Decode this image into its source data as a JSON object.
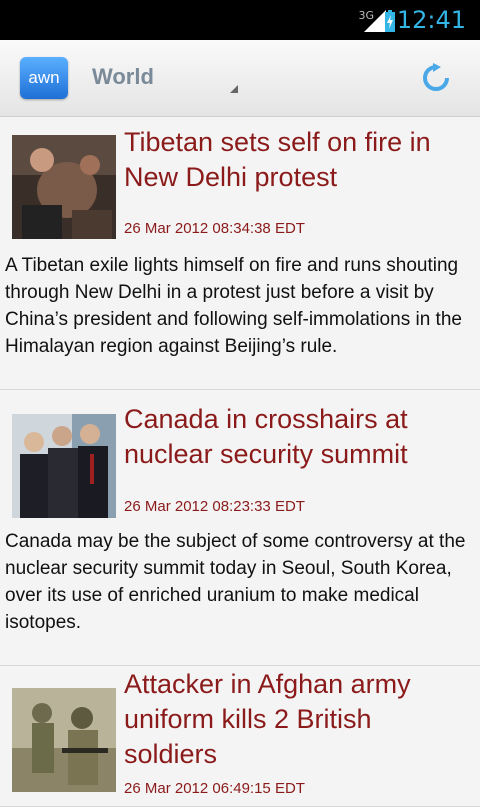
{
  "status_bar": {
    "network": "3G",
    "time": "12:41"
  },
  "action_bar": {
    "logo_text": "awn",
    "section": "World"
  },
  "articles": [
    {
      "title": "Tibetan sets self on fire in New Delhi protest",
      "date": "26 Mar 2012 08:34:38 EDT",
      "summary": "A Tibetan exile lights himself on fire and runs shouting through New Delhi in a protest just before a visit by China’s president and following self-immolations in the Himalayan region against Beijing’s rule."
    },
    {
      "title": "Canada in crosshairs at nuclear security summit",
      "date": "26 Mar 2012 08:23:33 EDT",
      "summary": "Canada may be the subject of some controversy at the nuclear security summit today in Seoul, South Korea, over its use of enriched uranium to make medical isotopes."
    },
    {
      "title": "Attacker in Afghan army uniform kills 2 British soldiers",
      "date": "26 Mar 2012 06:49:15 EDT",
      "summary": ""
    }
  ],
  "colors": {
    "headline": "#8b1a1a",
    "status_accent": "#33b5e5",
    "logo": "#2a7fe0"
  },
  "icons": [
    "signal-icon",
    "battery-icon",
    "refresh-icon",
    "dropdown-icon"
  ]
}
